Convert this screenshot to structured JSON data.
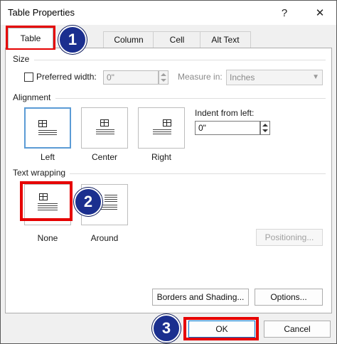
{
  "window": {
    "title": "Table Properties",
    "help_label": "?",
    "close_label": "✕"
  },
  "tabs": [
    {
      "label": "Table",
      "active": true
    },
    {
      "label": "Column"
    },
    {
      "label": "Cell"
    },
    {
      "label": "Alt Text"
    }
  ],
  "size": {
    "section_label": "Size",
    "preferred_width_label": "Preferred width:",
    "preferred_width_value": "0\"",
    "measure_in_label": "Measure in:",
    "measure_in_value": "Inches"
  },
  "alignment": {
    "section_label": "Alignment",
    "options": [
      "Left",
      "Center",
      "Right"
    ],
    "selected": "Left",
    "indent_label": "Indent from left:",
    "indent_value": "0\""
  },
  "text_wrapping": {
    "section_label": "Text wrapping",
    "options": [
      "None",
      "Around"
    ],
    "selected": "None",
    "positioning_label": "Positioning..."
  },
  "buttons": {
    "borders_label": "Borders and Shading...",
    "options_label": "Options...",
    "ok_label": "OK",
    "cancel_label": "Cancel"
  },
  "annotations": [
    "1",
    "2",
    "3"
  ],
  "colors": {
    "highlight_red": "#e60000",
    "badge_blue": "#1b2f8f",
    "selection_blue": "#5b9bd5"
  }
}
